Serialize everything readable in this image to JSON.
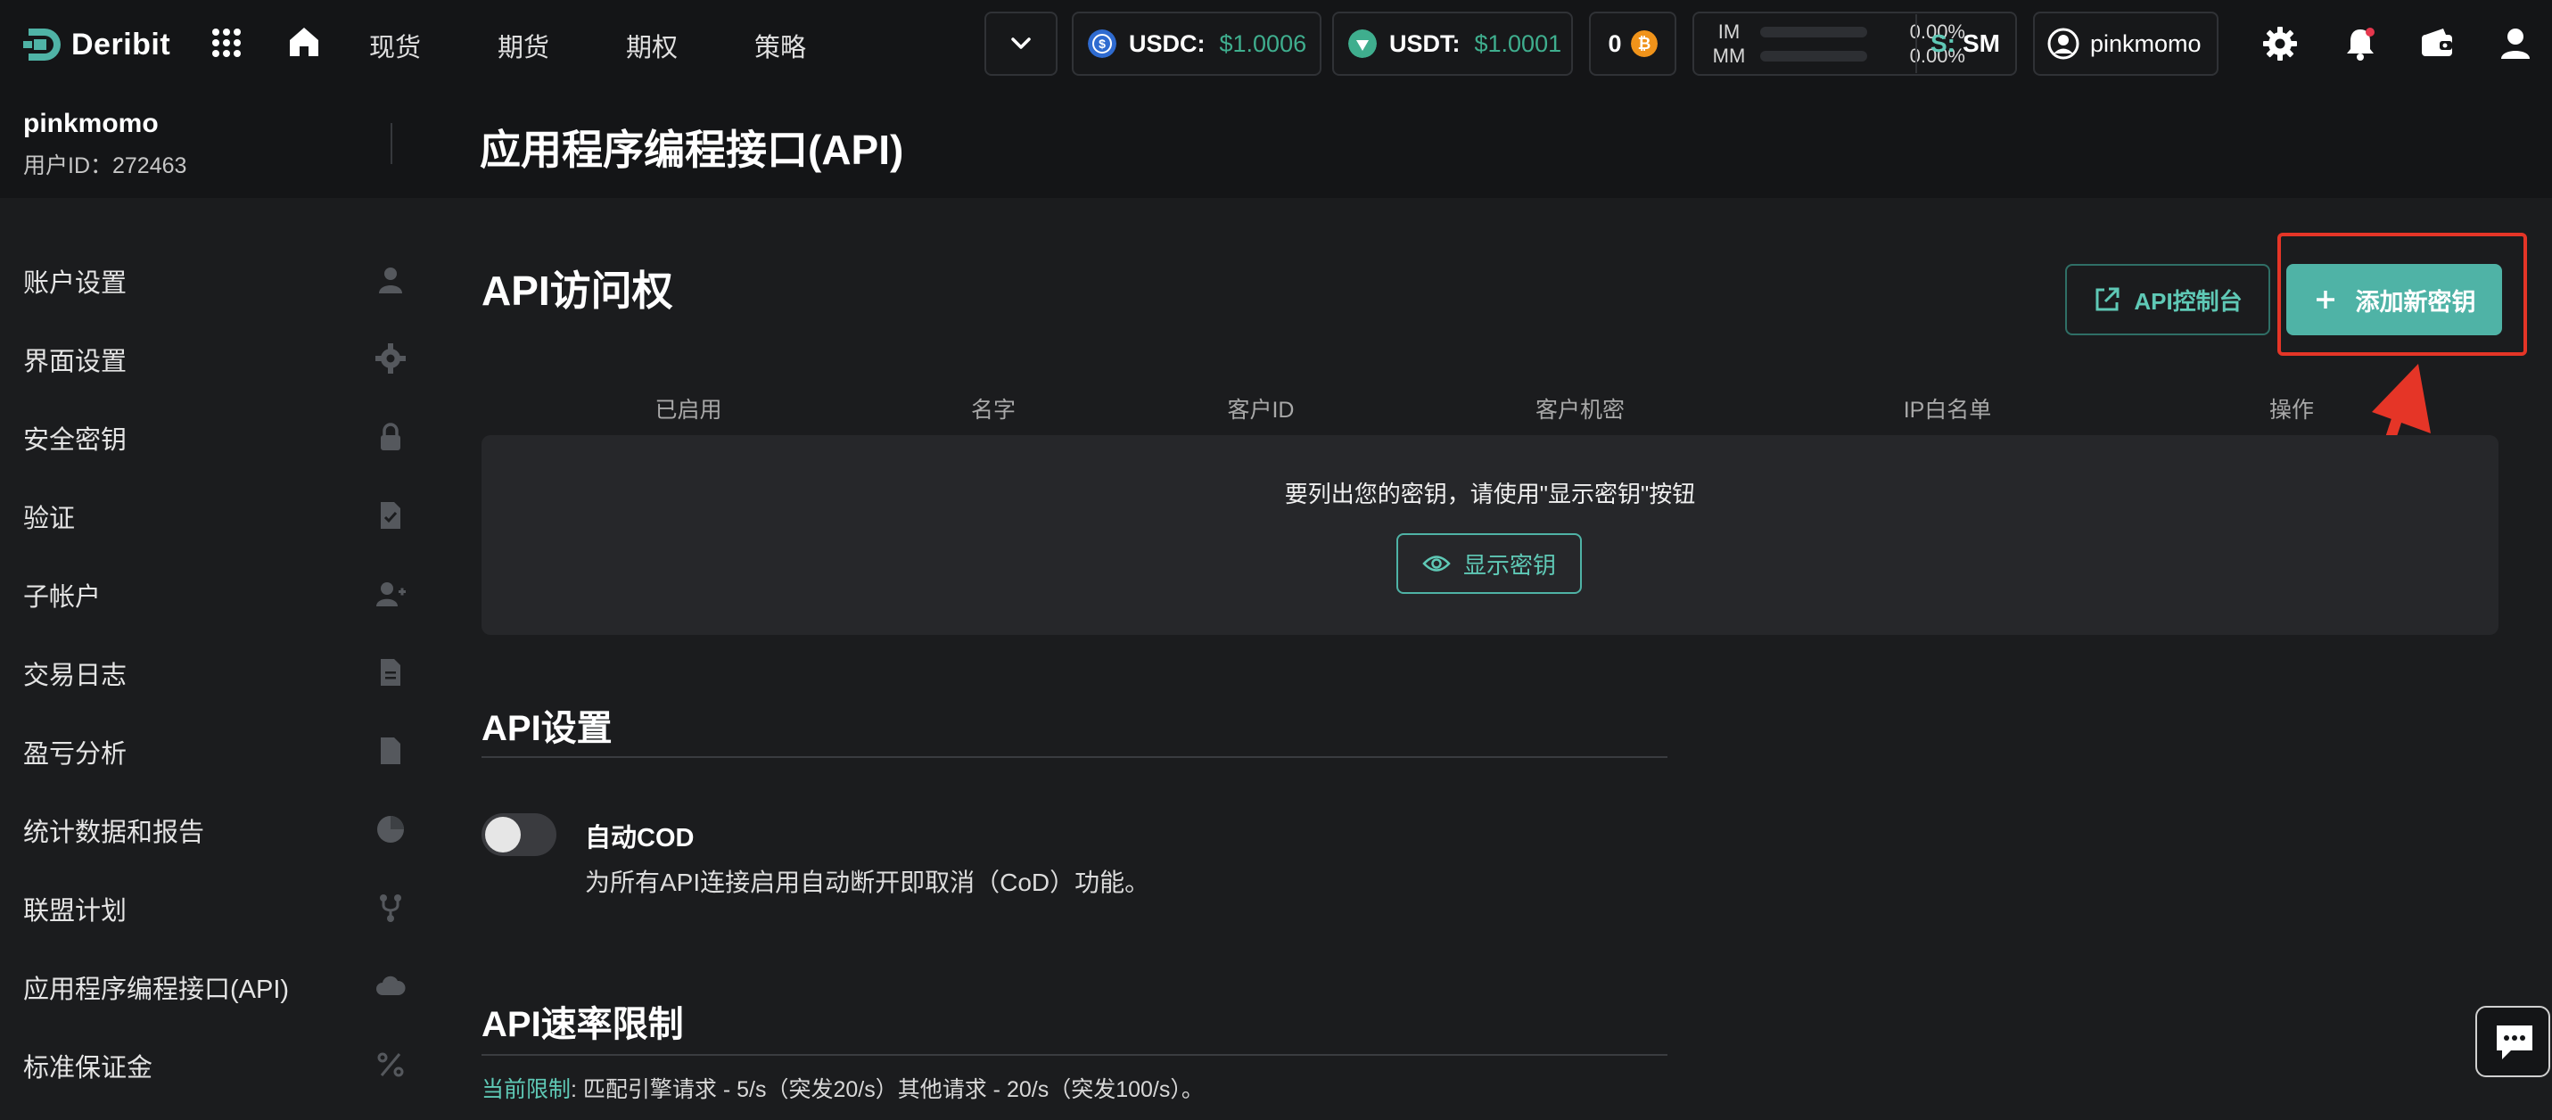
{
  "brand": {
    "name": "Deribit"
  },
  "nav": {
    "items": [
      "现货",
      "期货",
      "期权",
      "策略"
    ]
  },
  "tickers": [
    {
      "label": "USDC:",
      "value": "$1.0006",
      "icon": "usdc-coin-icon"
    },
    {
      "label": "USDT:",
      "value": "$1.0001",
      "icon": "usdt-coin-icon"
    }
  ],
  "btc_balance": "0",
  "margin": {
    "im_label": "IM",
    "im_value": "0.00%",
    "mm_label": "MM",
    "mm_value": "0.00%"
  },
  "margin_mode": {
    "prefix": "S:",
    "mode": "SM"
  },
  "user": {
    "name": "pinkmomo",
    "id_label": "用户ID：272463"
  },
  "page": {
    "title": "应用程序编程接口(API)"
  },
  "sidebar": {
    "items": [
      {
        "label": "账户设置",
        "icon": "user-icon"
      },
      {
        "label": "界面设置",
        "icon": "gear-icon"
      },
      {
        "label": "安全密钥",
        "icon": "lock-icon"
      },
      {
        "label": "验证",
        "icon": "document-check-icon"
      },
      {
        "label": "子帐户",
        "icon": "user-add-icon"
      },
      {
        "label": "交易日志",
        "icon": "document-icon"
      },
      {
        "label": "盈亏分析",
        "icon": "document-icon"
      },
      {
        "label": "统计数据和报告",
        "icon": "pie-chart-icon"
      },
      {
        "label": "联盟计划",
        "icon": "fork-icon"
      },
      {
        "label": "应用程序编程接口(API)",
        "icon": "cloud-icon"
      },
      {
        "label": "标准保证金",
        "icon": "percent-icon"
      }
    ]
  },
  "api_access": {
    "title": "API访问权",
    "console_button": "API控制台",
    "add_key_button": "添加新密钥",
    "columns": [
      "已启用",
      "名字",
      "客户ID",
      "客户机密",
      "IP白名单",
      "操作"
    ],
    "empty_message": "要列出您的密钥，请使用\"显示密钥\"按钮",
    "show_keys_button": "显示密钥"
  },
  "api_settings": {
    "title": "API设置",
    "auto_cod_title": "自动COD",
    "auto_cod_desc": "为所有API连接启用自动断开即取消（CoD）功能。",
    "auto_cod_enabled": false
  },
  "rate_limits": {
    "title": "API速率限制",
    "current_label": "当前限制",
    "current_text": ": 匹配引擎请求 - 5/s（突发20/s）其他请求 - 20/s（突发100/s）。"
  },
  "colors": {
    "accent": "#4fb3a6",
    "highlight": "#e53527",
    "positive": "#3fae8e"
  }
}
